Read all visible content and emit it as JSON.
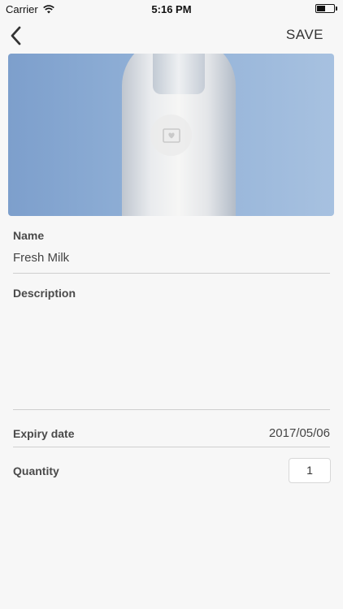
{
  "status_bar": {
    "carrier": "Carrier",
    "time": "5:16 PM"
  },
  "nav": {
    "back_icon": "chevron-left-icon",
    "save_label": "SAVE"
  },
  "photo": {
    "overlay_icon": "image-icon"
  },
  "form": {
    "name_label": "Name",
    "name_value": "Fresh Milk",
    "description_label": "Description",
    "description_value": "",
    "expiry_label": "Expiry date",
    "expiry_value": "2017/05/06",
    "quantity_label": "Quantity",
    "quantity_value": "1"
  },
  "colors": {
    "background": "#f7f7f7",
    "divider": "#cfcfcf",
    "text": "#333333"
  }
}
